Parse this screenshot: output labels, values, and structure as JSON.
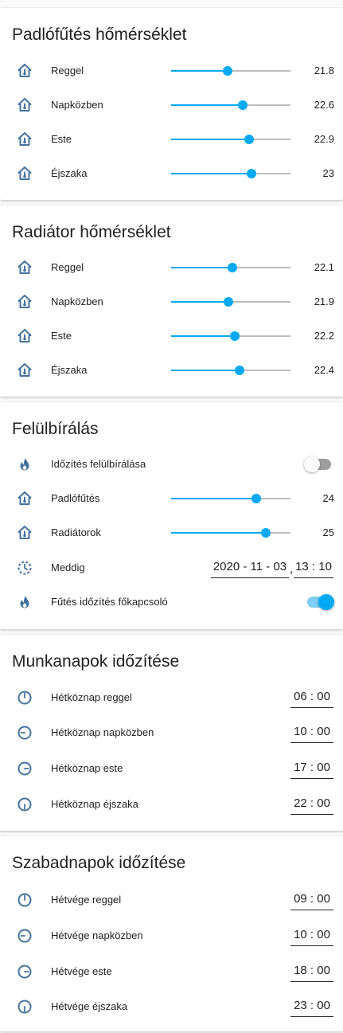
{
  "colors": {
    "accent": "#03a9f4",
    "icon": "#44739e",
    "track": "#bdbdbd"
  },
  "floor": {
    "title": "Padlófűtés hőmérséklet",
    "items": [
      {
        "icon": "home-thermometer-icon",
        "label": "Reggel",
        "value": "21.8",
        "fraction": 0.47
      },
      {
        "icon": "home-thermometer-icon",
        "label": "Napközben",
        "value": "22.6",
        "fraction": 0.6
      },
      {
        "icon": "home-thermometer-icon",
        "label": "Este",
        "value": "22.9",
        "fraction": 0.65
      },
      {
        "icon": "home-thermometer-icon",
        "label": "Éjszaka",
        "value": "23",
        "fraction": 0.67
      }
    ]
  },
  "radiator": {
    "title": "Radiátor hőmérséklet",
    "items": [
      {
        "icon": "home-thermometer-icon",
        "label": "Reggel",
        "value": "22.1",
        "fraction": 0.51
      },
      {
        "icon": "home-thermometer-icon",
        "label": "Napközben",
        "value": "21.9",
        "fraction": 0.48
      },
      {
        "icon": "home-thermometer-icon",
        "label": "Este",
        "value": "22.2",
        "fraction": 0.53
      },
      {
        "icon": "home-thermometer-icon",
        "label": "Éjszaka",
        "value": "22.4",
        "fraction": 0.57
      }
    ]
  },
  "override": {
    "title": "Felülbírálás",
    "timing_override": {
      "icon": "fire-icon",
      "label": "Időzítés felülbírálása",
      "state": "off"
    },
    "floor_heating": {
      "icon": "home-thermometer-icon",
      "label": "Padlófűtés",
      "value": "24",
      "fraction": 0.71
    },
    "radiators": {
      "icon": "home-thermometer-icon",
      "label": "Radiátorok",
      "value": "25",
      "fraction": 0.79
    },
    "until": {
      "icon": "timer-sand-icon",
      "label": "Meddig",
      "date": "2020 - 11 - 03",
      "separator": ",",
      "time": "13 : 10"
    },
    "master_switch": {
      "icon": "fire-icon",
      "label": "Fűtés időzítés főkapcsoló",
      "state": "on"
    }
  },
  "workdays": {
    "title": "Munkanapok időzítése",
    "items": [
      {
        "icon": "clock-icon",
        "label": "Hétköznap reggel",
        "time": "06 : 00"
      },
      {
        "icon": "clock-icon",
        "label": "Hétköznap napközben",
        "time": "10 : 00"
      },
      {
        "icon": "clock-icon",
        "label": "Hétköznap este",
        "time": "17 : 00"
      },
      {
        "icon": "clock-icon",
        "label": "Hétköznap éjszaka",
        "time": "22 : 00"
      }
    ]
  },
  "weekend": {
    "title": "Szabadnapok időzítése",
    "items": [
      {
        "icon": "clock-icon",
        "label": "Hétvége reggel",
        "time": "09 : 00"
      },
      {
        "icon": "clock-icon",
        "label": "Hétvége napközben",
        "time": "10 : 00"
      },
      {
        "icon": "clock-icon",
        "label": "Hétvége este",
        "time": "18 : 00"
      },
      {
        "icon": "clock-icon",
        "label": "Hétvége éjszaka",
        "time": "23 : 00"
      }
    ]
  }
}
